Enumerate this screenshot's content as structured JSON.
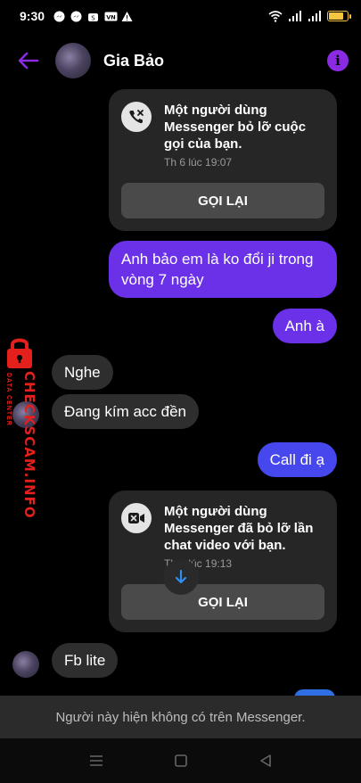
{
  "status": {
    "time": "9:30",
    "left_icons": [
      "messenger-icon",
      "messenger-icon",
      "shop-icon",
      "vn-icon",
      "warning-icon"
    ],
    "right_icons": [
      "wifi-icon",
      "signal-icon",
      "signal-icon",
      "battery-icon"
    ],
    "battery_level": 0.85,
    "battery_color": "#f5c542"
  },
  "header": {
    "contact_name": "Gia Bảo",
    "accent": "#8a2be2"
  },
  "messages": {
    "missed_call": {
      "title": "Một người dùng Messenger bỏ lỡ cuộc gọi của bạn.",
      "time": "Th 6 lúc 19:07",
      "button": "GỌI LẠI"
    },
    "out1": "Anh bảo em là ko đổi ji trong vòng 7 ngày",
    "out2": "Anh à",
    "in1": "Nghe",
    "in2": "Đang kím acc đền",
    "out3": "Call đi ạ",
    "missed_video": {
      "title": "Một người dùng Messenger đã bỏ lỡ lần chat video với bạn.",
      "time": "Th 6 lúc 19:13",
      "button": "GỌI LẠI"
    },
    "in3": "Fb lite"
  },
  "watermark": {
    "main": "CHECKSCAM.INFO",
    "sub": "DATA CENTER",
    "color": "#e3201b"
  },
  "notice": "Người này hiện không có trên Messenger.",
  "colors": {
    "outgoing_purple": "#6a31e8",
    "outgoing_blue": "#4747ee",
    "incoming": "#2e2e2e",
    "card": "#262626"
  }
}
